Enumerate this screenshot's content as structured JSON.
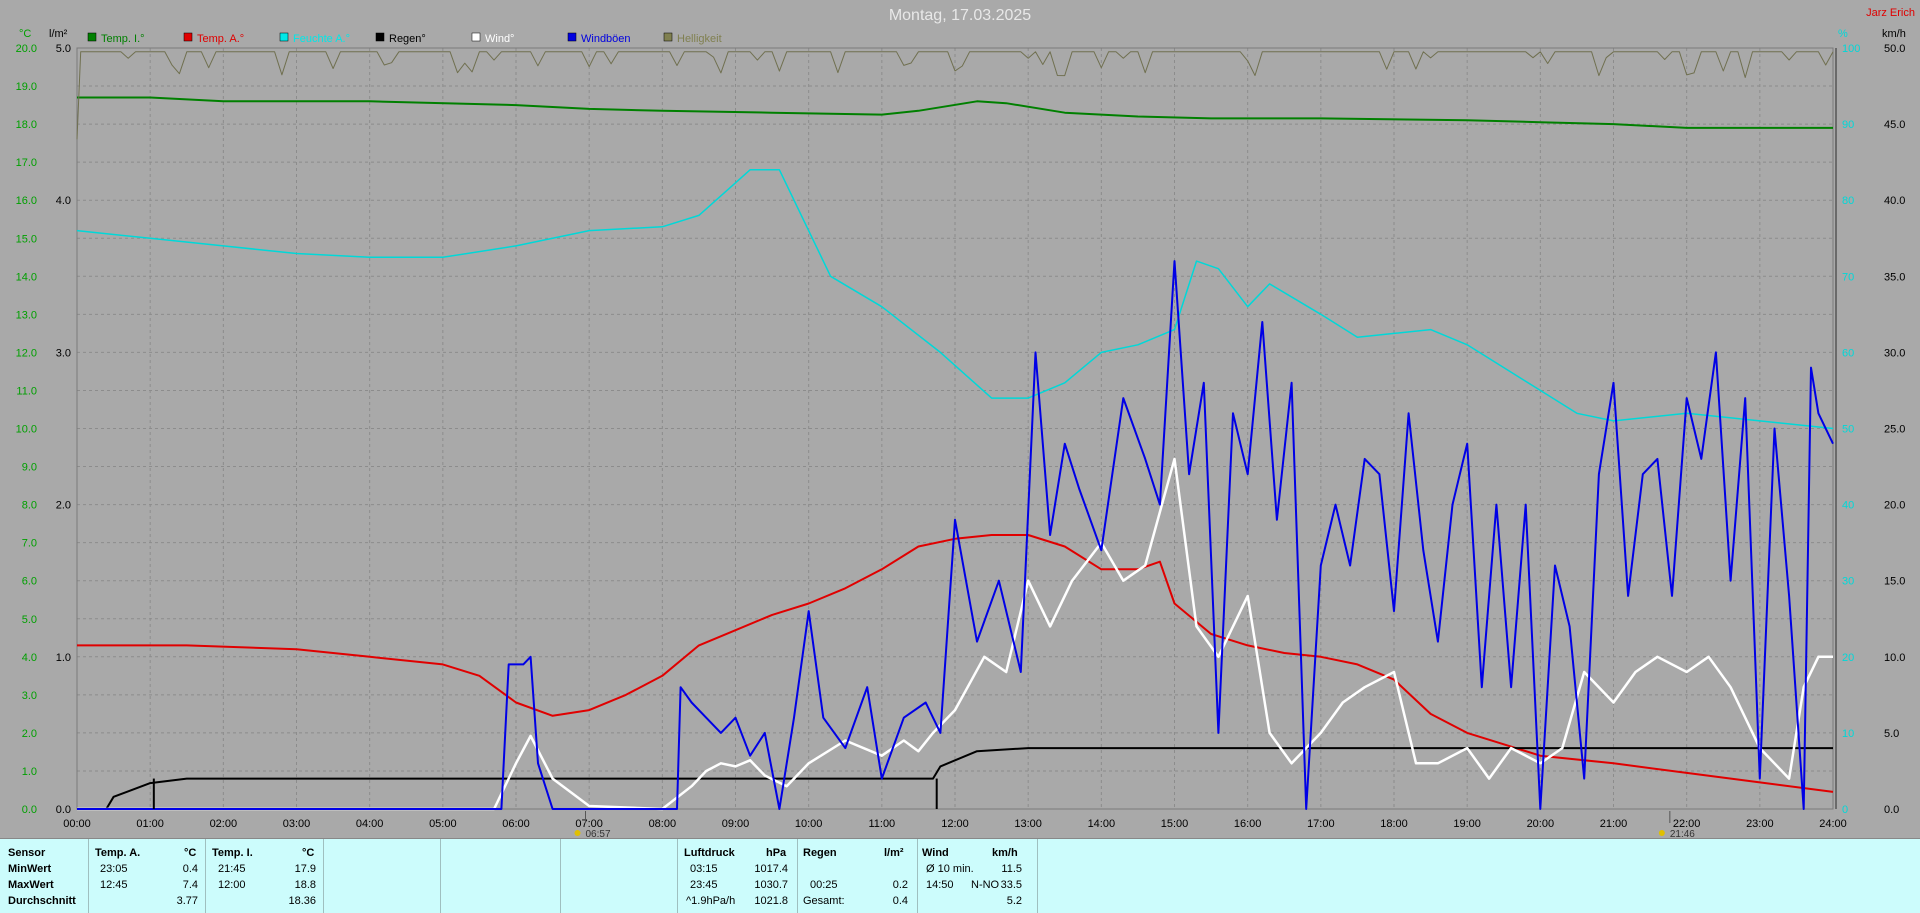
{
  "title": "Montag, 17.03.2025",
  "station": "Jarz Erich",
  "units": {
    "temp": "°C",
    "rain": "l/m²",
    "speed": "km/h",
    "pct": "%"
  },
  "legend": [
    {
      "label": "Temp. I.°",
      "color": "#008000"
    },
    {
      "label": "Temp. A.°",
      "color": "#e00000"
    },
    {
      "label": "Feuchte A.°",
      "color": "#00e8e8"
    },
    {
      "label": "Regen°",
      "color": "#000000"
    },
    {
      "label": "Wind°",
      "color": "#ffffff"
    },
    {
      "label": "Windböen",
      "color": "#0000e0"
    },
    {
      "label": "Helligkeit",
      "color": "#808050"
    }
  ],
  "markers": [
    {
      "x": 6.95,
      "label": "06:57"
    },
    {
      "x": 21.77,
      "label": "21:46"
    }
  ],
  "chart_data": {
    "type": "line",
    "x_range": [
      0,
      24
    ],
    "x_ticks": [
      "00:00",
      "01:00",
      "02:00",
      "03:00",
      "04:00",
      "05:00",
      "06:00",
      "07:00",
      "08:00",
      "09:00",
      "10:00",
      "11:00",
      "12:00",
      "13:00",
      "14:00",
      "15:00",
      "16:00",
      "17:00",
      "18:00",
      "19:00",
      "20:00",
      "21:00",
      "22:00",
      "23:00",
      "24:00"
    ],
    "y_left_temp": {
      "range": [
        0,
        20
      ],
      "ticks": [
        "0.0",
        "1.0",
        "2.0",
        "3.0",
        "4.0",
        "5.0",
        "6.0",
        "7.0",
        "8.0",
        "9.0",
        "10.0",
        "11.0",
        "12.0",
        "13.0",
        "14.0",
        "15.0",
        "16.0",
        "17.0",
        "18.0",
        "19.0",
        "20.0"
      ]
    },
    "y_left_rain": {
      "range": [
        0,
        5
      ],
      "ticks": [
        "0.0",
        "1.0",
        "2.0",
        "3.0",
        "4.0",
        "5.0"
      ]
    },
    "y_right_speed": {
      "range": [
        0,
        50
      ],
      "ticks": [
        "0.0",
        "5.0",
        "10.0",
        "15.0",
        "20.0",
        "25.0",
        "30.0",
        "35.0",
        "40.0",
        "45.0",
        "50.0"
      ]
    },
    "y_right_pct": {
      "range": [
        0,
        100
      ],
      "ticks": [
        "0",
        "10",
        "20",
        "30",
        "40",
        "50",
        "60",
        "70",
        "80",
        "90",
        "100"
      ]
    },
    "series": [
      {
        "name": "Temp. I.°",
        "axis": "temp",
        "color": "#008000",
        "width": 2,
        "points": [
          [
            0,
            18.7
          ],
          [
            1,
            18.7
          ],
          [
            2,
            18.6
          ],
          [
            4,
            18.6
          ],
          [
            6,
            18.5
          ],
          [
            7,
            18.4
          ],
          [
            8,
            18.35
          ],
          [
            9.5,
            18.3
          ],
          [
            11,
            18.25
          ],
          [
            11.5,
            18.35
          ],
          [
            12.3,
            18.6
          ],
          [
            12.7,
            18.55
          ],
          [
            13.5,
            18.3
          ],
          [
            14.5,
            18.2
          ],
          [
            15.5,
            18.15
          ],
          [
            17,
            18.15
          ],
          [
            19,
            18.1
          ],
          [
            20,
            18.05
          ],
          [
            21,
            18.0
          ],
          [
            22,
            17.9
          ],
          [
            24,
            17.9
          ]
        ]
      },
      {
        "name": "Feuchte A.°",
        "axis": "pct",
        "color": "#00d8d8",
        "width": 1.5,
        "points": [
          [
            0,
            76
          ],
          [
            1,
            75
          ],
          [
            2,
            74
          ],
          [
            3,
            73
          ],
          [
            4,
            72.5
          ],
          [
            5,
            72.5
          ],
          [
            6,
            74
          ],
          [
            7,
            76
          ],
          [
            8,
            76.5
          ],
          [
            8.5,
            78
          ],
          [
            9.2,
            84
          ],
          [
            9.6,
            84
          ],
          [
            10.3,
            70
          ],
          [
            11,
            66
          ],
          [
            11.8,
            60
          ],
          [
            12.5,
            54
          ],
          [
            13,
            54
          ],
          [
            13.5,
            56
          ],
          [
            14,
            60
          ],
          [
            14.5,
            61
          ],
          [
            15,
            63
          ],
          [
            15.3,
            72
          ],
          [
            15.6,
            71
          ],
          [
            16,
            66
          ],
          [
            16.3,
            69
          ],
          [
            17,
            65
          ],
          [
            17.5,
            62
          ],
          [
            18,
            62.5
          ],
          [
            18.5,
            63
          ],
          [
            19,
            61
          ],
          [
            19.5,
            58
          ],
          [
            20,
            55
          ],
          [
            20.5,
            52
          ],
          [
            21,
            51
          ],
          [
            22,
            52
          ],
          [
            23,
            51
          ],
          [
            24,
            50
          ]
        ]
      },
      {
        "name": "Temp. A.°",
        "axis": "temp",
        "color": "#e00000",
        "width": 2,
        "points": [
          [
            0,
            4.3
          ],
          [
            1.5,
            4.3
          ],
          [
            3,
            4.2
          ],
          [
            4,
            4.0
          ],
          [
            5,
            3.8
          ],
          [
            5.5,
            3.5
          ],
          [
            6,
            2.8
          ],
          [
            6.5,
            2.45
          ],
          [
            7,
            2.6
          ],
          [
            7.5,
            3.0
          ],
          [
            8,
            3.5
          ],
          [
            8.5,
            4.3
          ],
          [
            9,
            4.7
          ],
          [
            9.5,
            5.1
          ],
          [
            10,
            5.4
          ],
          [
            10.5,
            5.8
          ],
          [
            11,
            6.3
          ],
          [
            11.5,
            6.9
          ],
          [
            12,
            7.1
          ],
          [
            12.5,
            7.2
          ],
          [
            13,
            7.2
          ],
          [
            13.5,
            6.9
          ],
          [
            14,
            6.3
          ],
          [
            14.5,
            6.3
          ],
          [
            14.8,
            6.5
          ],
          [
            15,
            5.4
          ],
          [
            15.5,
            4.6
          ],
          [
            16,
            4.3
          ],
          [
            16.5,
            4.1
          ],
          [
            17,
            4.0
          ],
          [
            17.5,
            3.8
          ],
          [
            18,
            3.4
          ],
          [
            18.5,
            2.5
          ],
          [
            19,
            2.0
          ],
          [
            19.5,
            1.7
          ],
          [
            20,
            1.4
          ],
          [
            21,
            1.2
          ],
          [
            22,
            0.95
          ],
          [
            23,
            0.7
          ],
          [
            24,
            0.45
          ]
        ]
      },
      {
        "name": "Regen°",
        "axis": "rain",
        "color": "#000000",
        "width": 2,
        "points": [
          [
            0,
            0
          ],
          [
            0.4,
            0
          ],
          [
            0.5,
            0.08
          ],
          [
            1,
            0.17
          ],
          [
            1.5,
            0.2
          ],
          [
            11.7,
            0.2
          ],
          [
            11.8,
            0.28
          ],
          [
            12.3,
            0.38
          ],
          [
            13,
            0.4
          ],
          [
            24,
            0.4
          ]
        ]
      },
      {
        "name": "Wind°",
        "axis": "speed",
        "color": "#ffffff",
        "width": 2.5,
        "points": [
          [
            0,
            0
          ],
          [
            5.7,
            0
          ],
          [
            6,
            3
          ],
          [
            6.2,
            4.8
          ],
          [
            6.5,
            2
          ],
          [
            7,
            0.2
          ],
          [
            8,
            0
          ],
          [
            8.4,
            1.5
          ],
          [
            8.6,
            2.5
          ],
          [
            8.8,
            3
          ],
          [
            9,
            2.8
          ],
          [
            9.2,
            3.2
          ],
          [
            9.4,
            2.2
          ],
          [
            9.7,
            1.5
          ],
          [
            10,
            3
          ],
          [
            10.5,
            4.5
          ],
          [
            11,
            3.5
          ],
          [
            11.3,
            4.5
          ],
          [
            11.5,
            3.8
          ],
          [
            11.7,
            5
          ],
          [
            12,
            6.5
          ],
          [
            12.4,
            10
          ],
          [
            12.7,
            9
          ],
          [
            13,
            15
          ],
          [
            13.3,
            12
          ],
          [
            13.6,
            15
          ],
          [
            14,
            17.5
          ],
          [
            14.3,
            15
          ],
          [
            14.6,
            16
          ],
          [
            15,
            23
          ],
          [
            15.3,
            12
          ],
          [
            15.6,
            10
          ],
          [
            16,
            14
          ],
          [
            16.3,
            5
          ],
          [
            16.6,
            3
          ],
          [
            17,
            5
          ],
          [
            17.3,
            7
          ],
          [
            17.6,
            8
          ],
          [
            18,
            9
          ],
          [
            18.3,
            3
          ],
          [
            18.6,
            3
          ],
          [
            19,
            4
          ],
          [
            19.3,
            2
          ],
          [
            19.6,
            4
          ],
          [
            20,
            3
          ],
          [
            20.3,
            4
          ],
          [
            20.6,
            9
          ],
          [
            21,
            7
          ],
          [
            21.3,
            9
          ],
          [
            21.6,
            10
          ],
          [
            22,
            9
          ],
          [
            22.3,
            10
          ],
          [
            22.6,
            8
          ],
          [
            23,
            4
          ],
          [
            23.4,
            2
          ],
          [
            23.6,
            8
          ],
          [
            23.8,
            10
          ],
          [
            24,
            10
          ]
        ]
      },
      {
        "name": "Windböen",
        "axis": "speed",
        "color": "#0000e6",
        "width": 2,
        "points": [
          [
            0,
            0
          ],
          [
            5.8,
            0
          ],
          [
            5.9,
            9.5
          ],
          [
            6.1,
            9.5
          ],
          [
            6.2,
            10
          ],
          [
            6.3,
            3
          ],
          [
            6.5,
            0
          ],
          [
            8.2,
            0
          ],
          [
            8.25,
            8
          ],
          [
            8.4,
            7
          ],
          [
            8.6,
            6
          ],
          [
            8.8,
            5
          ],
          [
            9,
            6
          ],
          [
            9.2,
            3.5
          ],
          [
            9.4,
            5
          ],
          [
            9.6,
            0
          ],
          [
            9.8,
            6
          ],
          [
            10,
            13
          ],
          [
            10.2,
            6
          ],
          [
            10.5,
            4
          ],
          [
            10.8,
            8
          ],
          [
            11,
            2
          ],
          [
            11.3,
            6
          ],
          [
            11.6,
            7
          ],
          [
            11.8,
            5
          ],
          [
            12,
            19
          ],
          [
            12.3,
            11
          ],
          [
            12.6,
            15
          ],
          [
            12.9,
            9
          ],
          [
            13.1,
            30
          ],
          [
            13.3,
            18
          ],
          [
            13.5,
            24
          ],
          [
            13.7,
            21
          ],
          [
            14,
            17
          ],
          [
            14.3,
            27
          ],
          [
            14.6,
            23
          ],
          [
            14.8,
            20
          ],
          [
            15,
            36
          ],
          [
            15.2,
            22
          ],
          [
            15.4,
            28
          ],
          [
            15.6,
            5
          ],
          [
            15.8,
            26
          ],
          [
            16,
            22
          ],
          [
            16.2,
            32
          ],
          [
            16.4,
            19
          ],
          [
            16.6,
            28
          ],
          [
            16.8,
            0
          ],
          [
            17,
            16
          ],
          [
            17.2,
            20
          ],
          [
            17.4,
            16
          ],
          [
            17.6,
            23
          ],
          [
            17.8,
            22
          ],
          [
            18,
            13
          ],
          [
            18.2,
            26
          ],
          [
            18.4,
            17
          ],
          [
            18.6,
            11
          ],
          [
            18.8,
            20
          ],
          [
            19,
            24
          ],
          [
            19.2,
            8
          ],
          [
            19.4,
            20
          ],
          [
            19.6,
            8
          ],
          [
            19.8,
            20
          ],
          [
            20,
            0
          ],
          [
            20.2,
            16
          ],
          [
            20.4,
            12
          ],
          [
            20.6,
            2
          ],
          [
            20.8,
            22
          ],
          [
            21,
            28
          ],
          [
            21.2,
            14
          ],
          [
            21.4,
            22
          ],
          [
            21.6,
            23
          ],
          [
            21.8,
            14
          ],
          [
            22,
            27
          ],
          [
            22.2,
            23
          ],
          [
            22.4,
            30
          ],
          [
            22.6,
            15
          ],
          [
            22.8,
            27
          ],
          [
            23,
            2
          ],
          [
            23.2,
            25
          ],
          [
            23.4,
            14
          ],
          [
            23.6,
            0
          ],
          [
            23.7,
            29
          ],
          [
            23.8,
            26
          ],
          [
            24,
            24
          ]
        ]
      },
      {
        "name": "Helligkeit",
        "axis": "pct",
        "color": "#707050",
        "width": 1,
        "points": "noisy_top"
      }
    ]
  },
  "footer": {
    "sensor": {
      "h": "Sensor",
      "rows": [
        "MinWert",
        "MaxWert",
        "Durchschnitt"
      ]
    },
    "tempA": {
      "h": "Temp. A.",
      "unit": "°C",
      "times": [
        "23:05",
        "12:45",
        ""
      ],
      "values": [
        "0.4",
        "7.4",
        "3.77"
      ]
    },
    "tempI": {
      "h": "Temp. I.",
      "unit": "°C",
      "times": [
        "21:45",
        "12:00",
        ""
      ],
      "values": [
        "17.9",
        "18.8",
        "18.36"
      ]
    },
    "press": {
      "h": "Luftdruck",
      "unit": "hPa",
      "times": [
        "03:15",
        "23:45",
        "^1.9hPa/h"
      ],
      "values": [
        "1017.4",
        "1030.7",
        "1021.8"
      ]
    },
    "rain": {
      "h": "Regen",
      "unit": "l/m²",
      "times": [
        "",
        "00:25",
        "Gesamt:"
      ],
      "values": [
        "",
        "0.2",
        "0.4"
      ]
    },
    "wind": {
      "h": "Wind",
      "unit": "km/h",
      "labels": [
        "Ø 10 min.",
        "14:50",
        ""
      ],
      "dirs": [
        "",
        "N-NO",
        ""
      ],
      "values": [
        "11.5",
        "33.5",
        "5.2"
      ]
    }
  }
}
